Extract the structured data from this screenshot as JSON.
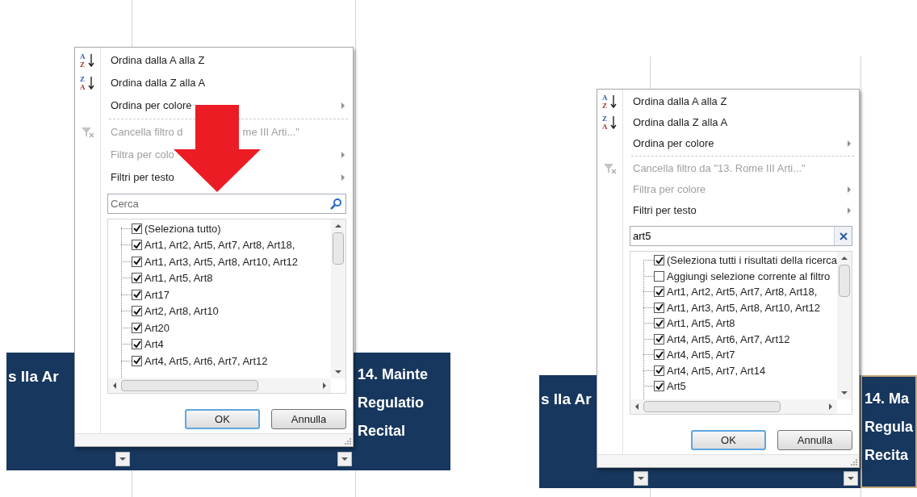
{
  "panels": [
    {
      "arrow": true,
      "menu": [
        {
          "kind": "sort",
          "label": "Ordina dalla A alla Z",
          "icon_letters": [
            "A",
            "Z"
          ],
          "disabled": false,
          "submenu": false
        },
        {
          "kind": "sort",
          "label": "Ordina dalla Z alla A",
          "icon_letters": [
            "Z",
            "A"
          ],
          "disabled": false,
          "submenu": false
        },
        {
          "kind": "plain",
          "label": "Ordina per colore",
          "disabled": false,
          "submenu": true
        },
        {
          "kind": "clear_filter",
          "label": "Cancella filtro d",
          "label_tail": "me III Arti...\"",
          "disabled": true,
          "submenu": false
        },
        {
          "kind": "plain",
          "label": "Filtra per colo",
          "disabled": true,
          "submenu": true
        },
        {
          "kind": "plain",
          "label": "Filtri per testo",
          "disabled": false,
          "submenu": true
        }
      ],
      "search": {
        "placeholder": "Cerca"
      },
      "list": [
        {
          "label": "(Seleziona tutto)",
          "checked": true
        },
        {
          "label": "Art1, Art2, Art5, Art7, Art8, Art18,",
          "checked": true
        },
        {
          "label": "Art1, Art3, Art5, Art8, Art10, Art12",
          "checked": true
        },
        {
          "label": "Art1, Art5, Art8",
          "checked": true
        },
        {
          "label": "Art17",
          "checked": true
        },
        {
          "label": "Art2, Art8, Art10",
          "checked": true
        },
        {
          "label": "Art20",
          "checked": true
        },
        {
          "label": "Art4",
          "checked": true
        },
        {
          "label": "Art4, Art5, Art6, Art7, Art12",
          "checked": true
        }
      ],
      "buttons": [
        {
          "label": "OK",
          "default": true
        },
        {
          "label": "Annulla",
          "default": false
        }
      ],
      "sheet": {
        "left_header": "s IIa Ar",
        "right_header": [
          "14. Mainte",
          "Regulatio",
          "Recital"
        ],
        "right_selected": false
      }
    },
    {
      "arrow": false,
      "menu": [
        {
          "kind": "sort",
          "label": "Ordina dalla A alla Z",
          "icon_letters": [
            "A",
            "Z"
          ],
          "disabled": false,
          "submenu": false
        },
        {
          "kind": "sort",
          "label": "Ordina dalla Z alla A",
          "icon_letters": [
            "Z",
            "A"
          ],
          "disabled": false,
          "submenu": false
        },
        {
          "kind": "plain",
          "label": "Ordina per colore",
          "disabled": false,
          "submenu": true
        },
        {
          "kind": "clear_filter",
          "label": "Cancella filtro da \"13. Rome III Arti...\"",
          "disabled": true,
          "submenu": false
        },
        {
          "kind": "plain",
          "label": "Filtra per colore",
          "disabled": true,
          "submenu": true
        },
        {
          "kind": "plain",
          "label": "Filtri per testo",
          "disabled": false,
          "submenu": true
        }
      ],
      "search": {
        "value": "art5"
      },
      "list": [
        {
          "label": "(Seleziona tutti i risultati della ricerca",
          "checked": true
        },
        {
          "label": "Aggiungi selezione corrente al filtro",
          "checked": false
        },
        {
          "label": "Art1, Art2, Art5, Art7, Art8, Art18,",
          "checked": true
        },
        {
          "label": "Art1, Art3, Art5, Art8, Art10, Art12",
          "checked": true
        },
        {
          "label": "Art1, Art5, Art8",
          "checked": true
        },
        {
          "label": "Art4, Art5, Art6, Art7, Art12",
          "checked": true
        },
        {
          "label": "Art4, Art5, Art7",
          "checked": true
        },
        {
          "label": "Art4, Art5, Art7, Art14",
          "checked": true
        },
        {
          "label": "Art5",
          "checked": true
        }
      ],
      "buttons": [
        {
          "label": "OK",
          "default": true
        },
        {
          "label": "Annulla",
          "default": false
        }
      ],
      "sheet": {
        "left_header": "s IIa Ar",
        "right_header": [
          "14. Ma",
          "Regula",
          "Recita"
        ],
        "right_selected": true
      }
    }
  ]
}
